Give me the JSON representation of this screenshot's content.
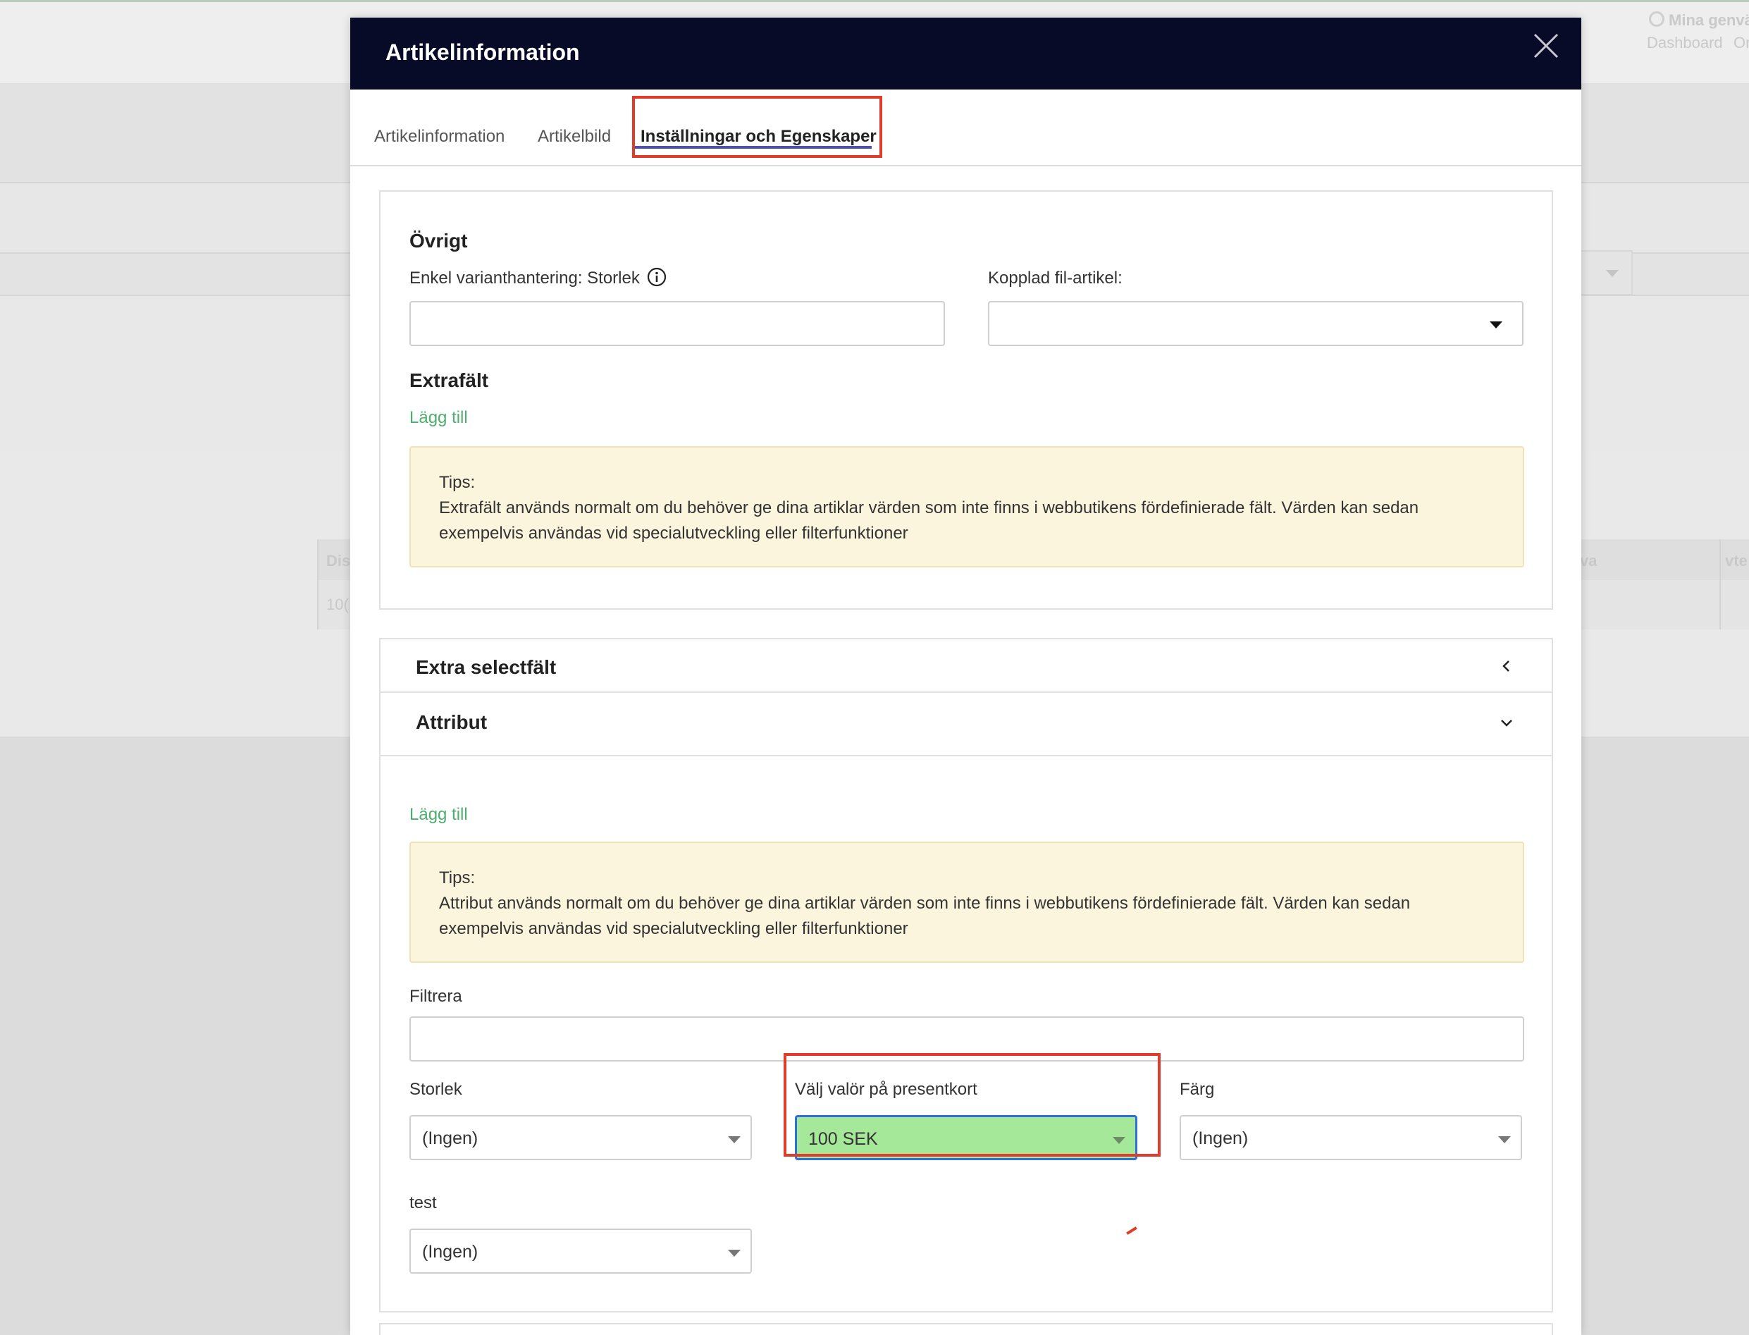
{
  "background": {
    "top_right_shortcut": "Mina genväg",
    "top_right_nav": [
      "Dashboard",
      "Or"
    ],
    "table_head_left": "Dis",
    "table_head_right_a": "va",
    "table_head_right_b": "vte",
    "table_cell_left": "10("
  },
  "modal": {
    "title": "Artikelinformation",
    "tabs": [
      {
        "label": "Artikelinformation",
        "active": false
      },
      {
        "label": "Artikelbild",
        "active": false
      },
      {
        "label": "Inställningar och Egenskaper",
        "active": true
      }
    ],
    "ovrigt": {
      "title": "Övrigt",
      "variant_label": "Enkel varianthantering: Storlek",
      "variant_value": "",
      "linked_file_label": "Kopplad fil-artikel:",
      "linked_file_value": ""
    },
    "extrafalt": {
      "title": "Extrafält",
      "add_label": "Lägg till",
      "tip_heading": "Tips:",
      "tip_text": "Extrafält används normalt om du behöver ge dina artiklar värden som inte finns i webbutikens fördefinierade fält. Värden kan sedan exempelvis användas vid specialutveckling eller filterfunktioner"
    },
    "extra_select": {
      "title": "Extra selectfält"
    },
    "attribut": {
      "title": "Attribut",
      "add_label": "Lägg till",
      "tip_heading": "Tips:",
      "tip_text": "Attribut används normalt om du behöver ge dina artiklar värden som inte finns i webbutikens fördefinierade fält. Värden kan sedan exempelvis användas vid specialutveckling eller filterfunktioner",
      "filter_label": "Filtrera",
      "filter_value": "",
      "fields": [
        {
          "label": "Storlek",
          "value": "(Ingen)"
        },
        {
          "label": "Välj valör på presentkort",
          "value": "100 SEK"
        },
        {
          "label": "Färg",
          "value": "(Ingen)"
        },
        {
          "label": "test",
          "value": "(Ingen)"
        }
      ]
    }
  },
  "colors": {
    "header_bg": "#080b27",
    "link_green": "#4caf6e",
    "tip_bg": "#fcf5dd",
    "highlight_red": "#e03c2c",
    "selected_green": "#a6e89a",
    "tab_underline": "#4b4fb5"
  }
}
